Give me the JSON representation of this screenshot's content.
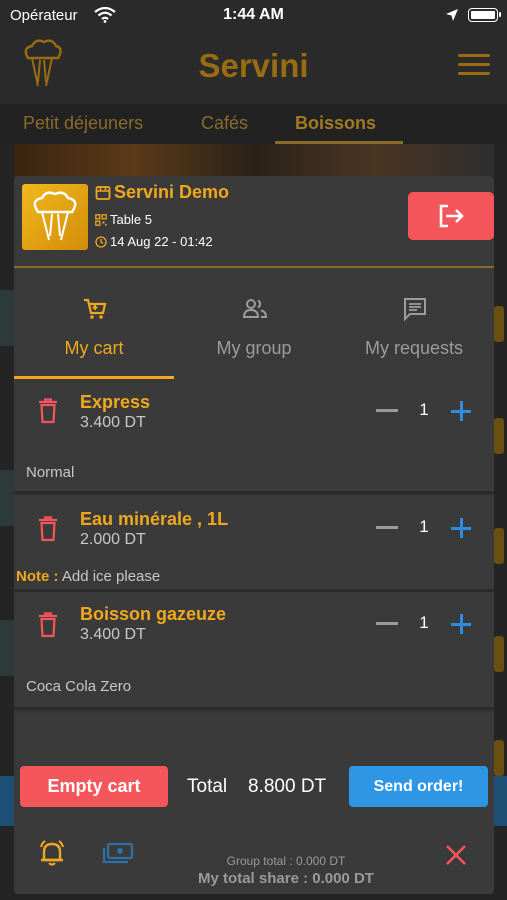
{
  "status_bar": {
    "carrier": "Opérateur",
    "time": "1:44 AM"
  },
  "app_header": {
    "title": "Servini",
    "title_color": "#9a6c12"
  },
  "categories": [
    {
      "label": "Petit déjeuners",
      "active": false
    },
    {
      "label": "Cafés",
      "active": false
    },
    {
      "label": "Boissons",
      "active": true
    }
  ],
  "cart_modal": {
    "restaurant_name": "Servini Demo",
    "table": "Table 5",
    "datetime": "14 Aug 22 - 01:42",
    "tabs": [
      {
        "label": "My cart",
        "icon": "cart-icon",
        "active": true
      },
      {
        "label": "My group",
        "icon": "group-icon",
        "active": false
      },
      {
        "label": "My requests",
        "icon": "message-icon",
        "active": false
      }
    ],
    "items": [
      {
        "name": "Express",
        "price": "3.400 DT",
        "quantity": "1",
        "note_label": "",
        "note": "Normal"
      },
      {
        "name": "Eau minérale , 1L",
        "price": "2.000 DT",
        "quantity": "1",
        "note_label": "Note :",
        "note": "Add ice please"
      },
      {
        "name": "Boisson gazeuze",
        "price": "3.400 DT",
        "quantity": "1",
        "note_label": "",
        "note": "Coca Cola Zero"
      }
    ],
    "empty_cart_label": "Empty cart",
    "total_label": "Total",
    "total_value": "8.800 DT",
    "send_order_label": "Send order!",
    "group_total": "Group total : 0.000 DT",
    "my_total_share": "My total share : 0.000 DT"
  },
  "colors": {
    "accent": "#f0a81e",
    "danger": "#f5565c",
    "primary": "#2f96e6",
    "modal_bg": "#3a3a3a"
  }
}
